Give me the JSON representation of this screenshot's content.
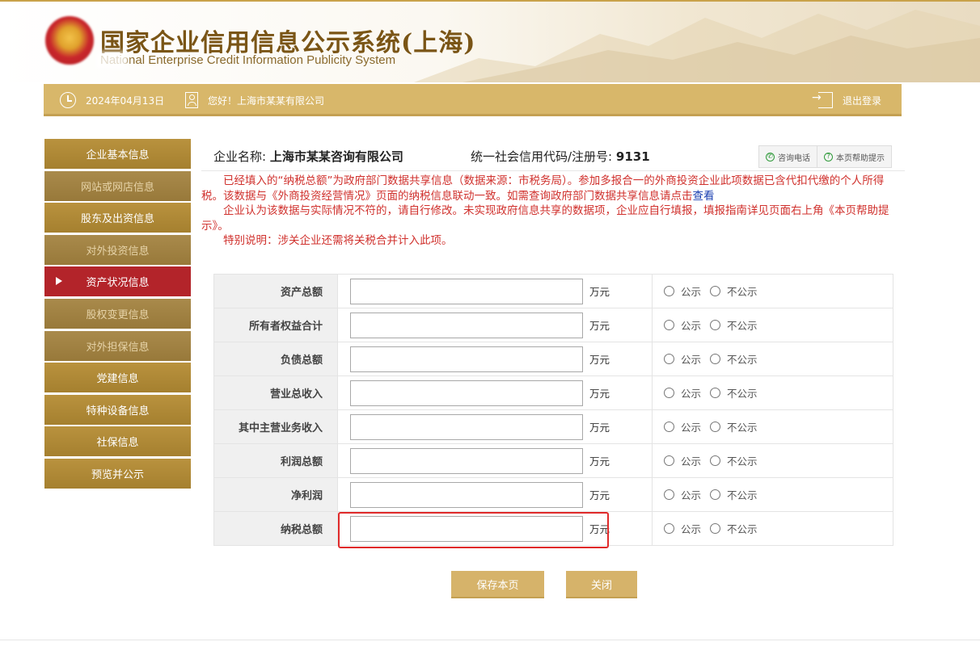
{
  "header": {
    "title": "国家企业信用信息公示系统(上海)",
    "subtitle": "National Enterprise Credit Information Publicity System"
  },
  "userbar": {
    "date": "2024年04月13日",
    "greeting": "您好！上海市某某有限公司",
    "logout": "退出登录"
  },
  "sidebar": {
    "items": [
      {
        "label": "企业基本信息",
        "state": "normal"
      },
      {
        "label": "网站或网店信息",
        "state": "dim"
      },
      {
        "label": "股东及出资信息",
        "state": "normal"
      },
      {
        "label": "对外投资信息",
        "state": "dim"
      },
      {
        "label": "资产状况信息",
        "state": "active"
      },
      {
        "label": "股权变更信息",
        "state": "dim"
      },
      {
        "label": "对外担保信息",
        "state": "dim"
      },
      {
        "label": "党建信息",
        "state": "normal"
      },
      {
        "label": "特种设备信息",
        "state": "normal"
      },
      {
        "label": "社保信息",
        "state": "normal"
      },
      {
        "label": "预览并公示",
        "state": "normal"
      }
    ]
  },
  "company": {
    "name_label": "企业名称:",
    "name_value": "上海市某某咨询有限公司",
    "code_label": "统一社会信用代码/注册号:",
    "code_value": "9131"
  },
  "help": {
    "phone": "咨询电话",
    "help_tip": "本页帮助提示"
  },
  "notice": {
    "p1": "已经填入的“纳税总额”为政府部门数据共享信息（数据来源：市税务局）。参加多报合一的外商投资企业此项数据已含代扣代缴的个人所得税。该数据与《外商投资经营情况》页面的纳税信息联动一致。如需查询政府部门数据共享信息请点击",
    "p1_link": "查看",
    "p2": "企业认为该数据与实际情况不符的，请自行修改。未实现政府信息共享的数据项，企业应自行填报，填报指南详见页面右上角《本页帮助提示》。",
    "p3": "特别说明：涉关企业还需将关税合并计入此项。"
  },
  "form": {
    "unit": "万元",
    "opt_public": "公示",
    "opt_private": "不公示",
    "rows": [
      {
        "label": "资产总额",
        "value": ""
      },
      {
        "label": "所有者权益合计",
        "value": ""
      },
      {
        "label": "负债总额",
        "value": ""
      },
      {
        "label": "营业总收入",
        "value": ""
      },
      {
        "label": "其中主营业务收入",
        "value": ""
      },
      {
        "label": "利润总额",
        "value": ""
      },
      {
        "label": "净利润",
        "value": ""
      },
      {
        "label": "纳税总额",
        "value": ""
      }
    ]
  },
  "buttons": {
    "save": "保存本页",
    "close": "关闭"
  },
  "colors": {
    "gold": "#d8b76a",
    "sidebar_active": "#b3242a",
    "notice_red": "#d0312d",
    "highlight": "#e02a2a"
  }
}
